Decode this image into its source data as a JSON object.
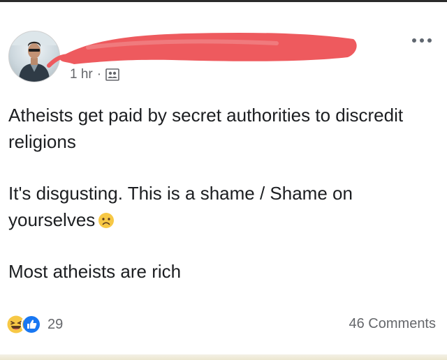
{
  "post": {
    "timestamp": "1 hr",
    "separator": "·",
    "audience_icon": "friends-icon",
    "paragraphs": [
      "Atheists get paid by secret authorities to discredit religions",
      "It's disgusting. This is a shame / Shame on yourselves",
      "Most atheists are rich"
    ],
    "emoji": "sad-face-emoji"
  },
  "footer": {
    "reactions": [
      "haha-reaction",
      "like-reaction"
    ],
    "reaction_count": "29",
    "comments_label": "46 Comments"
  },
  "colors": {
    "redaction": "#ee5a5e",
    "meta_text": "#65676b",
    "like_blue": "#1877f2",
    "emoji_yellow": "#f7c845"
  }
}
